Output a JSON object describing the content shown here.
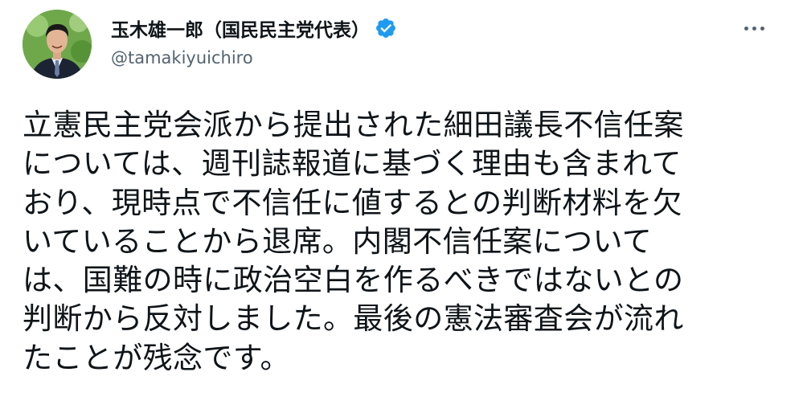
{
  "author": {
    "display_name": "玉木雄一郎（国民民主党代表）",
    "handle": "@tamakiyuichiro",
    "verified_icon": "verified-badge-icon",
    "avatar_icon": "profile-photo",
    "verified_color": "#1d9bf0"
  },
  "menu": {
    "icon": "more-options-icon"
  },
  "tweet": {
    "lines": [
      "立憲民主党会派から提出された細田議長不信任案",
      "については、週刊誌報道に基づく理由も含まれて",
      "おり、現時点で不信任に値するとの判断材料を欠",
      "いていることから退席。内閣不信任案について",
      "は、国難の時に政治空白を作るべきではないとの",
      "判断から反対しました。最後の憲法審査会が流れ",
      "たことが残念です。"
    ]
  }
}
